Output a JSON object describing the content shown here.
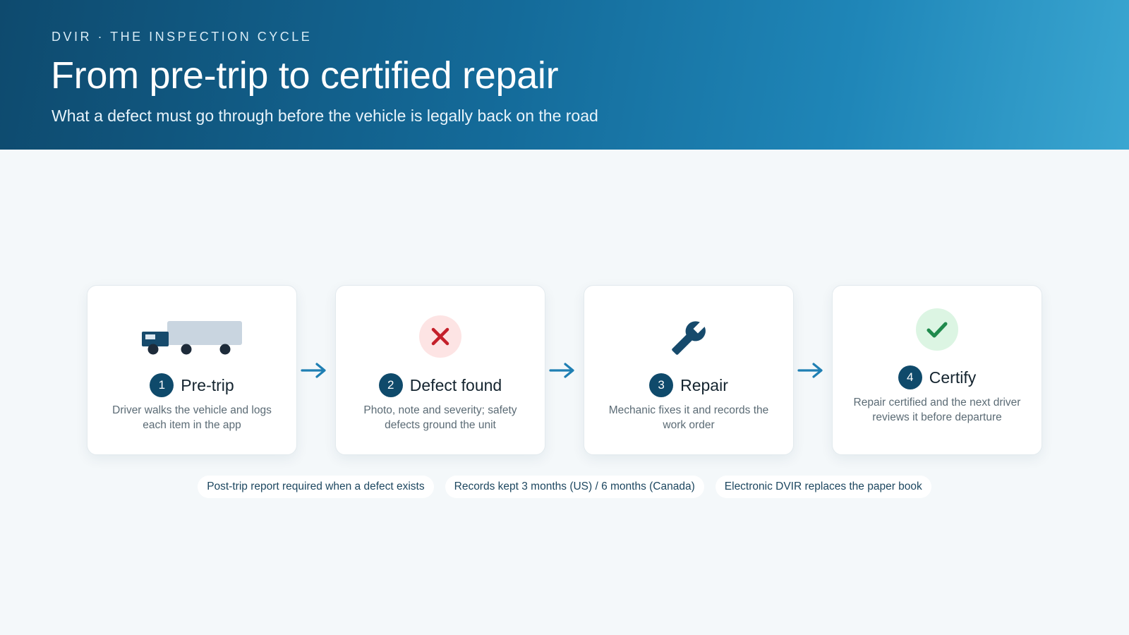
{
  "header": {
    "eyebrow": "DVIR · THE INSPECTION CYCLE",
    "title": "From pre-trip to certified repair",
    "subtitle": "What a defect must go through before the vehicle is legally back on the road"
  },
  "steps": [
    {
      "number": "1",
      "title": "Pre-trip",
      "description": "Driver walks the vehicle and logs each item in the app",
      "icon": "truck-icon"
    },
    {
      "number": "2",
      "title": "Defect found",
      "description": "Photo, note and severity; safety defects ground the unit",
      "icon": "x-mark-icon"
    },
    {
      "number": "3",
      "title": "Repair",
      "description": "Mechanic fixes it and records the work order",
      "icon": "wrench-icon"
    },
    {
      "number": "4",
      "title": "Certify",
      "description": "Repair certified and the next driver reviews it before departure",
      "icon": "checkmark-icon"
    }
  ],
  "notes": [
    "Post-trip report required when a defect exists",
    "Records kept 3 months (US) / 6 months (Canada)",
    "Electronic DVIR replaces the paper book"
  ],
  "colors": {
    "accent": "#0f4a6b",
    "arrow": "#1f7fb3",
    "defect": "#c4202b",
    "defect_bg": "#fde4e4",
    "success": "#1f8a4c",
    "success_bg": "#dcf5e3"
  }
}
